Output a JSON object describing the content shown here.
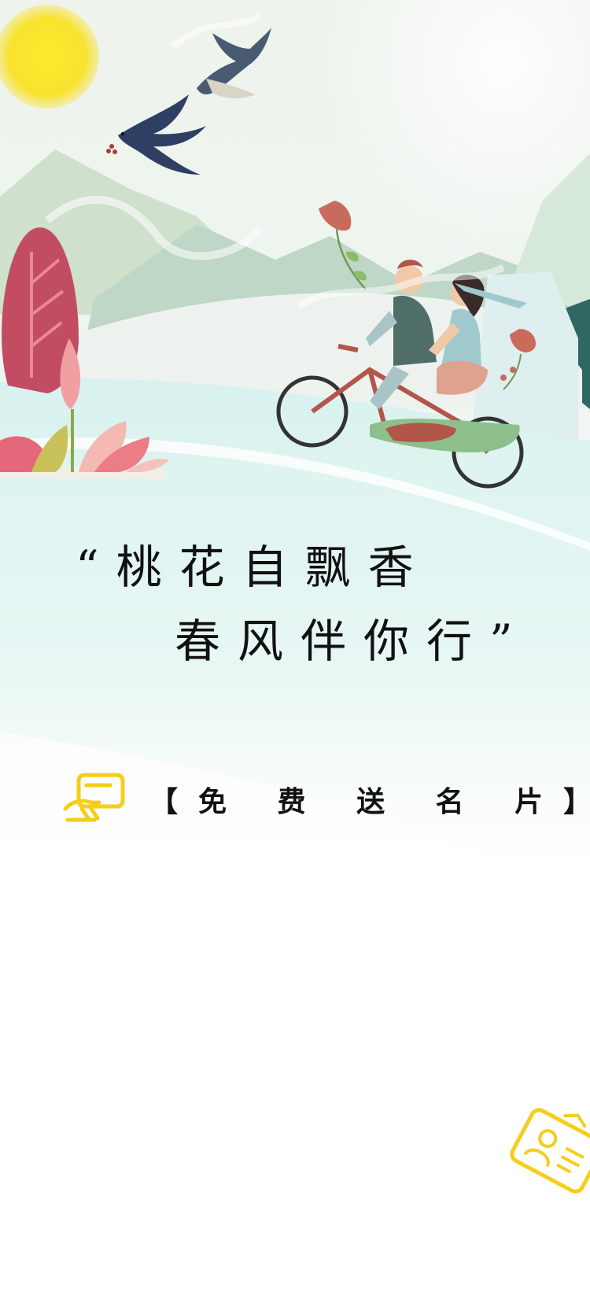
{
  "poem": {
    "line_1": "“桃花自飘香",
    "line_2": "春风伴你行”"
  },
  "promo": {
    "label": "【免 费 送 名 片】",
    "icon": "business-card-hand-icon"
  },
  "decorations": {
    "corner_icon": "id-card-icon",
    "accent_color": "#F5CE1A",
    "text_color": "#111111",
    "scene": [
      "sun",
      "swallow",
      "swallow",
      "mountains",
      "flowers",
      "tandem-bicycle-couple"
    ]
  }
}
